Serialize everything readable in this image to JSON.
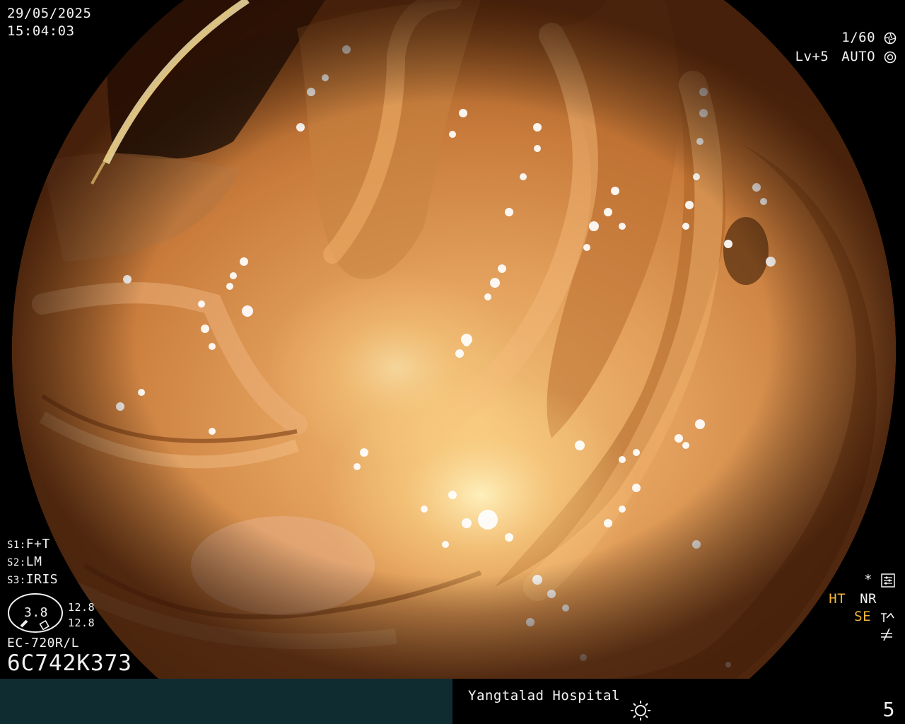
{
  "overlay": {
    "date": "29/05/2025",
    "time": "15:04:03",
    "shutter": "1/60",
    "shutter_icon": "aperture-icon",
    "level": "Lv+5",
    "exposure_mode": "AUTO",
    "exposure_icon": "iris-icon",
    "switches": [
      {
        "key": "S1:",
        "value": "F+T"
      },
      {
        "key": "S2:",
        "value": "LM"
      },
      {
        "key": "S3:",
        "value": "IRIS"
      }
    ],
    "tip_gauge": {
      "value": "3.8",
      "upper": "12.8",
      "lower": "12.8"
    },
    "scope_model": "EC-720R/L",
    "serial": "6C742K373",
    "right_status": {
      "star": "*",
      "ht": "HT",
      "nr": "NR",
      "se": "SE"
    }
  },
  "footer": {
    "hospital": "Yangtalad Hospital",
    "light_icon": "brightness-icon",
    "frame_number": "5"
  },
  "colors": {
    "tissue": "#d9904a",
    "overlay_text": "#f2f2f2",
    "amber_text": "#f4b63a",
    "footer_left": "#0f2c31"
  }
}
